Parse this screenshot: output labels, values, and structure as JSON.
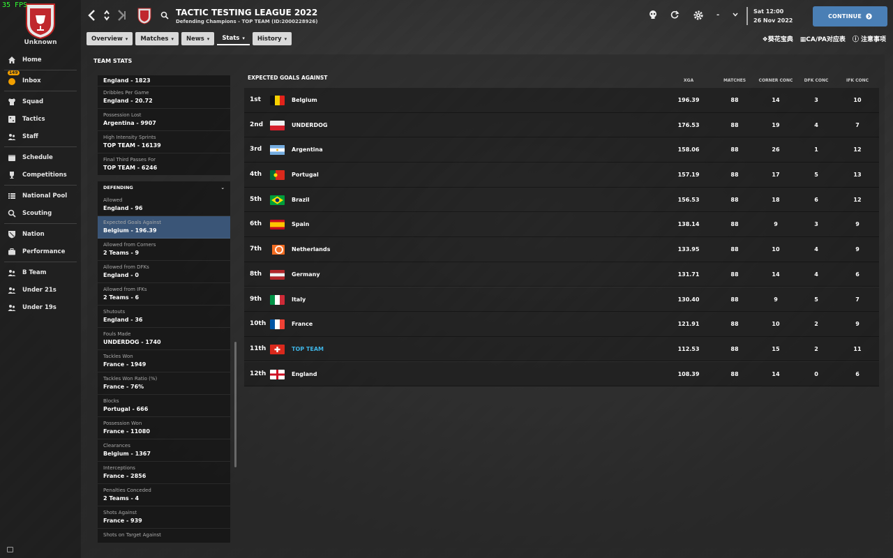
{
  "fps": "35 FPS",
  "sidebar": {
    "club_name": "Unknown",
    "inbox_badge": "149",
    "items": [
      {
        "label": "Home",
        "icon": "home-icon"
      },
      {
        "label": "Inbox",
        "icon": "inbox-icon"
      },
      {
        "label": "Squad",
        "icon": "shirt-icon"
      },
      {
        "label": "Tactics",
        "icon": "tactics-board-icon"
      },
      {
        "label": "Staff",
        "icon": "staff-icon"
      },
      {
        "label": "Schedule",
        "icon": "calendar-icon"
      },
      {
        "label": "Competitions",
        "icon": "trophy-icon"
      },
      {
        "label": "National Pool",
        "icon": "list-icon"
      },
      {
        "label": "Scouting",
        "icon": "magnifier-icon"
      },
      {
        "label": "Nation",
        "icon": "shield-icon"
      },
      {
        "label": "Performance",
        "icon": "briefcase-icon"
      },
      {
        "label": "B Team",
        "icon": "b-team-icon"
      },
      {
        "label": "Under 21s",
        "icon": "u21-icon"
      },
      {
        "label": "Under 19s",
        "icon": "u19-icon"
      }
    ]
  },
  "header": {
    "title": "TACTIC TESTING LEAGUE 2022",
    "subtitle": "Defending Champions - TOP TEAM (ID:2000228926)",
    "dash": "-",
    "date_line1": "Sat 12:00",
    "date_line2": "26 Nov 2022",
    "continue_label": "CONTINUE"
  },
  "tabs": [
    {
      "label": "Overview"
    },
    {
      "label": "Matches"
    },
    {
      "label": "News"
    },
    {
      "label": "Stats"
    },
    {
      "label": "History"
    }
  ],
  "toplinks": [
    "葵花宝典",
    "CA/PA对应表",
    "注意事项"
  ],
  "panel_title": "TEAM STATS",
  "left_panel": {
    "top_group": [
      {
        "label": "",
        "value": "England - 1823"
      },
      {
        "label": "Dribbles Per Game",
        "value": "England - 20.72"
      },
      {
        "label": "Possession Lost",
        "value": "Argentina - 9907"
      },
      {
        "label": "High Intensity Sprints",
        "value": "TOP TEAM - 16139"
      },
      {
        "label": "Final Third Passes For",
        "value": "TOP TEAM - 6246"
      }
    ],
    "defending_label": "DEFENDING",
    "defending": [
      {
        "label": "Allowed",
        "value": "England - 96"
      },
      {
        "label": "Expected Goals Against",
        "value": "Belgium - 196.39"
      },
      {
        "label": "Allowed from Corners",
        "value": "2 Teams - 9"
      },
      {
        "label": "Allowed from DFKs",
        "value": "England - 0"
      },
      {
        "label": "Allowed from IFKs",
        "value": "2 Teams - 6"
      },
      {
        "label": "Shutouts",
        "value": "England - 36"
      },
      {
        "label": "Fouls Made",
        "value": "UNDERDOG - 1740"
      },
      {
        "label": "Tackles Won",
        "value": "France - 1949"
      },
      {
        "label": "Tackles Won Ratio (%)",
        "value": "France - 76%"
      },
      {
        "label": "Blocks",
        "value": "Portugal - 666"
      },
      {
        "label": "Possession Won",
        "value": "France - 11080"
      },
      {
        "label": "Clearances",
        "value": "Belgium - 1367"
      },
      {
        "label": "Interceptions",
        "value": "France - 2856"
      },
      {
        "label": "Penalties Conceded",
        "value": "2 Teams - 4"
      },
      {
        "label": "Shots Against",
        "value": "France - 939"
      },
      {
        "label": "Shots on Target Against",
        "value": ""
      }
    ]
  },
  "table": {
    "title": "EXPECTED GOALS AGAINST",
    "headers": [
      "XGA",
      "MATCHES",
      "CORNER CONC",
      "DFK CONC",
      "IFK CONC"
    ],
    "rows": [
      {
        "rank": "1st",
        "team": "Belgium",
        "flag": "belgium",
        "xga": "196.39",
        "matches": "88",
        "corner": "14",
        "dfk": "3",
        "ifk": "10"
      },
      {
        "rank": "2nd",
        "team": "UNDERDOG",
        "flag": "underdog",
        "xga": "176.53",
        "matches": "88",
        "corner": "19",
        "dfk": "4",
        "ifk": "7"
      },
      {
        "rank": "3rd",
        "team": "Argentina",
        "flag": "argentina",
        "xga": "158.06",
        "matches": "88",
        "corner": "26",
        "dfk": "1",
        "ifk": "12"
      },
      {
        "rank": "4th",
        "team": "Portugal",
        "flag": "portugal",
        "xga": "157.19",
        "matches": "88",
        "corner": "17",
        "dfk": "5",
        "ifk": "13"
      },
      {
        "rank": "5th",
        "team": "Brazil",
        "flag": "brazil",
        "xga": "156.53",
        "matches": "88",
        "corner": "18",
        "dfk": "6",
        "ifk": "12"
      },
      {
        "rank": "6th",
        "team": "Spain",
        "flag": "spain",
        "xga": "138.14",
        "matches": "88",
        "corner": "9",
        "dfk": "3",
        "ifk": "9"
      },
      {
        "rank": "7th",
        "team": "Netherlands",
        "flag": "netherlands",
        "xga": "133.95",
        "matches": "88",
        "corner": "10",
        "dfk": "4",
        "ifk": "9"
      },
      {
        "rank": "8th",
        "team": "Germany",
        "flag": "germany",
        "xga": "131.71",
        "matches": "88",
        "corner": "14",
        "dfk": "4",
        "ifk": "6"
      },
      {
        "rank": "9th",
        "team": "Italy",
        "flag": "italy",
        "xga": "130.40",
        "matches": "88",
        "corner": "9",
        "dfk": "5",
        "ifk": "7"
      },
      {
        "rank": "10th",
        "team": "France",
        "flag": "france",
        "xga": "121.91",
        "matches": "88",
        "corner": "10",
        "dfk": "2",
        "ifk": "9"
      },
      {
        "rank": "11th",
        "team": "TOP TEAM",
        "flag": "topteam",
        "xga": "112.53",
        "matches": "88",
        "corner": "15",
        "dfk": "2",
        "ifk": "11"
      },
      {
        "rank": "12th",
        "team": "England",
        "flag": "england",
        "xga": "108.39",
        "matches": "88",
        "corner": "14",
        "dfk": "0",
        "ifk": "6"
      }
    ]
  },
  "colors": {
    "accent": "#4a7fb5",
    "selected_row": "#3a5577",
    "highlight_team": "#3fb5e6",
    "fps": "#33ff33"
  }
}
